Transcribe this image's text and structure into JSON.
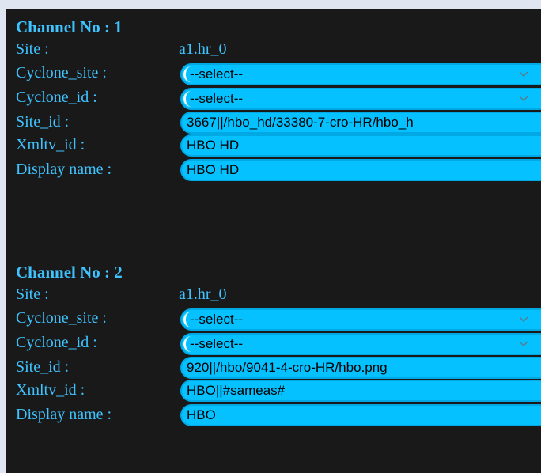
{
  "channels": [
    {
      "heading": "Channel No : 1",
      "site_label": "Site :",
      "site_value": "a1.hr_0",
      "cyclone_site_label": "Cyclone_site :",
      "cyclone_site_value": "--select--",
      "cyclone_id_label": "Cyclone_id :",
      "cyclone_id_value": "--select--",
      "site_id_label": "Site_id :",
      "site_id_value": "3667||/hbo_hd/33380-7-cro-HR/hbo_h",
      "xmltv_id_label": "Xmltv_id :",
      "xmltv_id_value": "HBO HD",
      "display_name_label": "Display name :",
      "display_name_value": "HBO HD"
    },
    {
      "heading": "Channel No : 2",
      "site_label": "Site :",
      "site_value": "a1.hr_0",
      "cyclone_site_label": "Cyclone_site :",
      "cyclone_site_value": "--select--",
      "cyclone_id_label": "Cyclone_id :",
      "cyclone_id_value": "--select--",
      "site_id_label": "Site_id :",
      "site_id_value": "920||/hbo/9041-4-cro-HR/hbo.png",
      "xmltv_id_label": "Xmltv_id :",
      "xmltv_id_value": "HBO||#sameas#",
      "display_name_label": "Display name :",
      "display_name_value": "HBO"
    }
  ],
  "icons": {
    "dropdown": "chevron-down-icon"
  },
  "colors": {
    "page_background": "#dfe6f1",
    "panel_background": "#191919",
    "label_text": "#3ec3ff",
    "field_fill": "#05c1ff",
    "field_text": "#000000"
  }
}
